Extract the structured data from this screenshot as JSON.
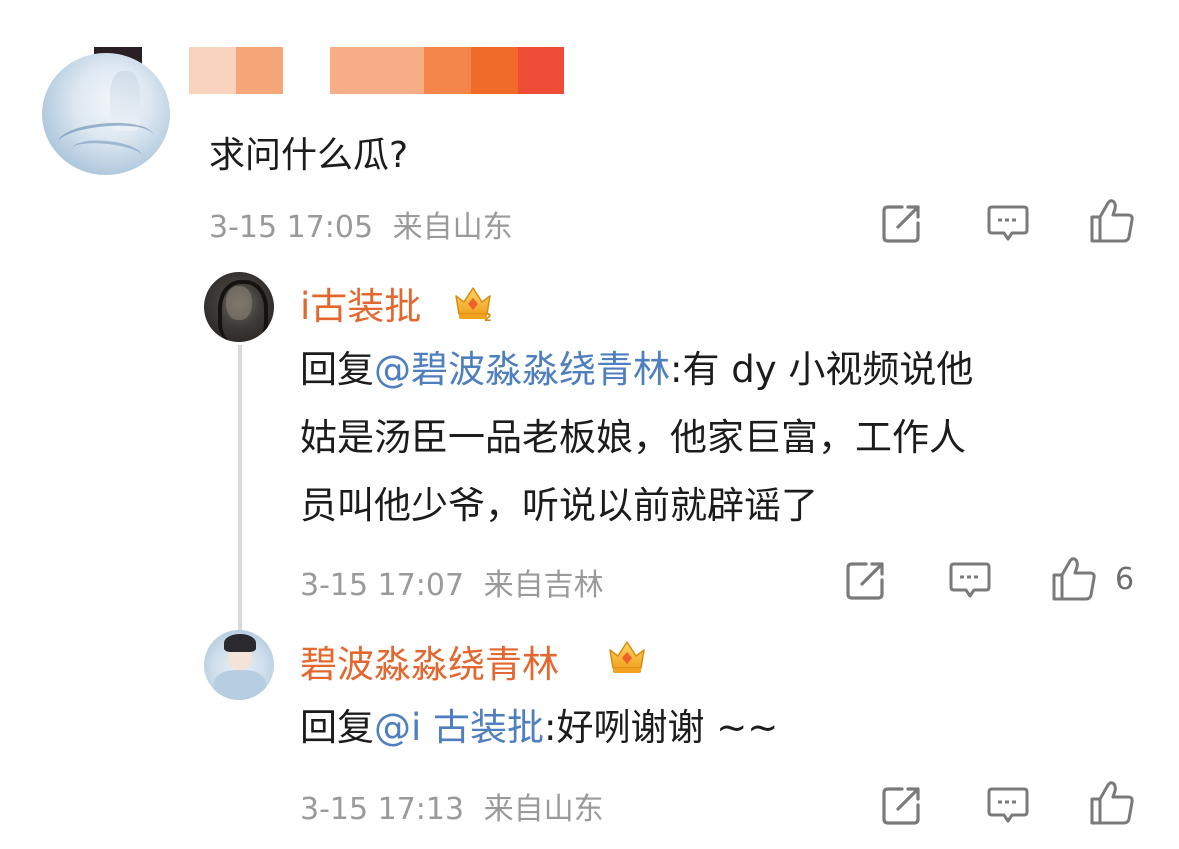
{
  "comment": {
    "text": "求问什么瓜?",
    "time": "3-15 17:05",
    "location": "来自山东",
    "icons": [
      "share-icon",
      "comment-icon",
      "like-icon"
    ]
  },
  "replies": [
    {
      "username": "i古装批",
      "badge_icon": "crown-badge-icon",
      "badge_level": "2",
      "reply_prefix": "回复",
      "mention": "@碧波淼淼绕青林",
      "text_line1": ":有 dy 小视频说他",
      "text_line2": "姑是汤臣一品老板娘，他家巨富，工作人",
      "text_line3": "员叫他少爷，听说以前就辟谣了",
      "time": "3-15 17:07",
      "location": "来自吉林",
      "like_count": "6"
    },
    {
      "username": "碧波淼淼绕青林",
      "badge_icon": "crown-badge-icon",
      "reply_prefix": "回复",
      "mention": "@i 古装批",
      "text": ":好咧谢谢 ~~",
      "time": "3-15 17:13",
      "location": "来自山东"
    }
  ],
  "colors": {
    "username": "#e4672f",
    "mention": "#4f7fbf",
    "meta": "#9a9a9a",
    "mosaic": [
      "#2b1f26",
      "#f9d3bd",
      "#f6a679",
      "#f7ae87",
      "#f59d6b",
      "#f3844a",
      "#f06a2a",
      "#ef4c37"
    ]
  }
}
